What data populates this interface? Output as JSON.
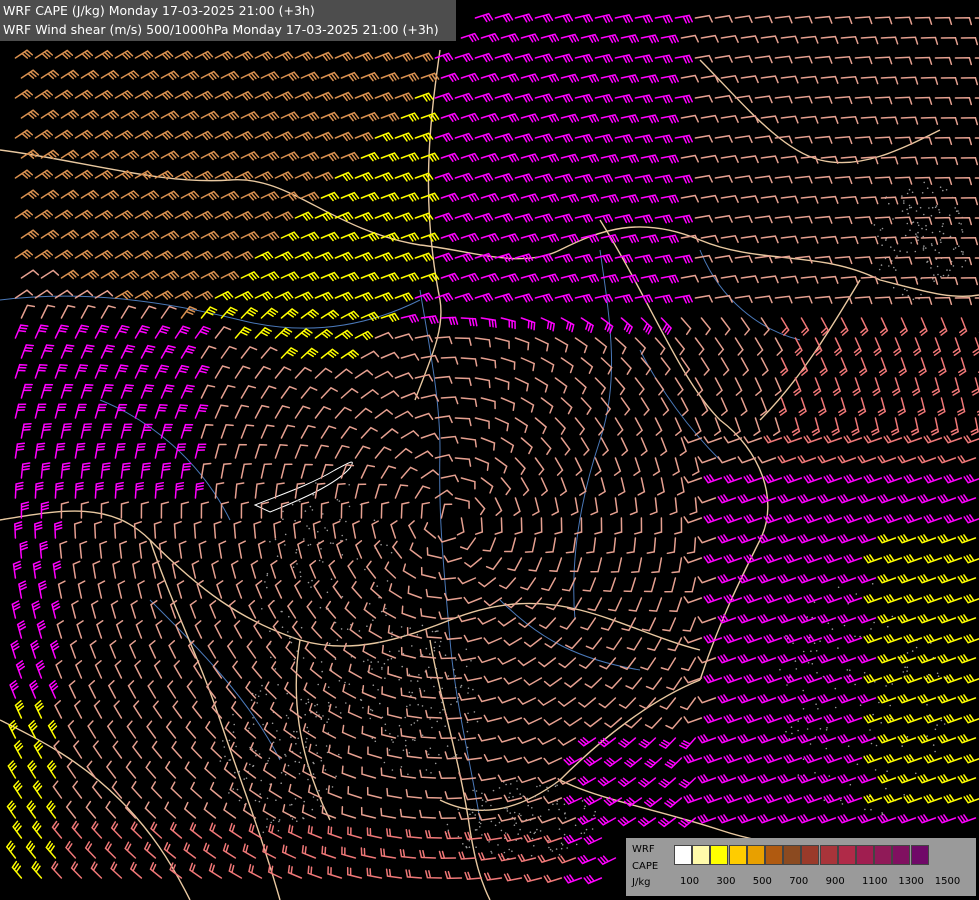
{
  "title": {
    "line1": "WRF CAPE (J/kg) Monday 17-03-2025 21:00 (+3h)",
    "line2": "WRF Wind shear (m/s) 500/1000hPa Monday 17-03-2025 21:00 (+3h)"
  },
  "legend": {
    "label_line1": "WRF",
    "label_line2": "CAPE",
    "label_line3": "J/kg",
    "tick_labels": [
      "100",
      "300",
      "500",
      "700",
      "900",
      "1100",
      "1300",
      "1500"
    ],
    "colors": [
      "#ffffff",
      "#fffaaa",
      "#ffff00",
      "#ffcc00",
      "#e8a000",
      "#b05a10",
      "#8b4a20",
      "#9a3a2a",
      "#a8343a",
      "#b02a48",
      "#a01e50",
      "#901a58",
      "#801060",
      "#700868"
    ]
  },
  "wind_colors": {
    "weak": "#e6a090",
    "moderate": "#f07878",
    "strong": "#ff00ff",
    "very_strong": "#ffff00",
    "orange": "#d89050"
  }
}
